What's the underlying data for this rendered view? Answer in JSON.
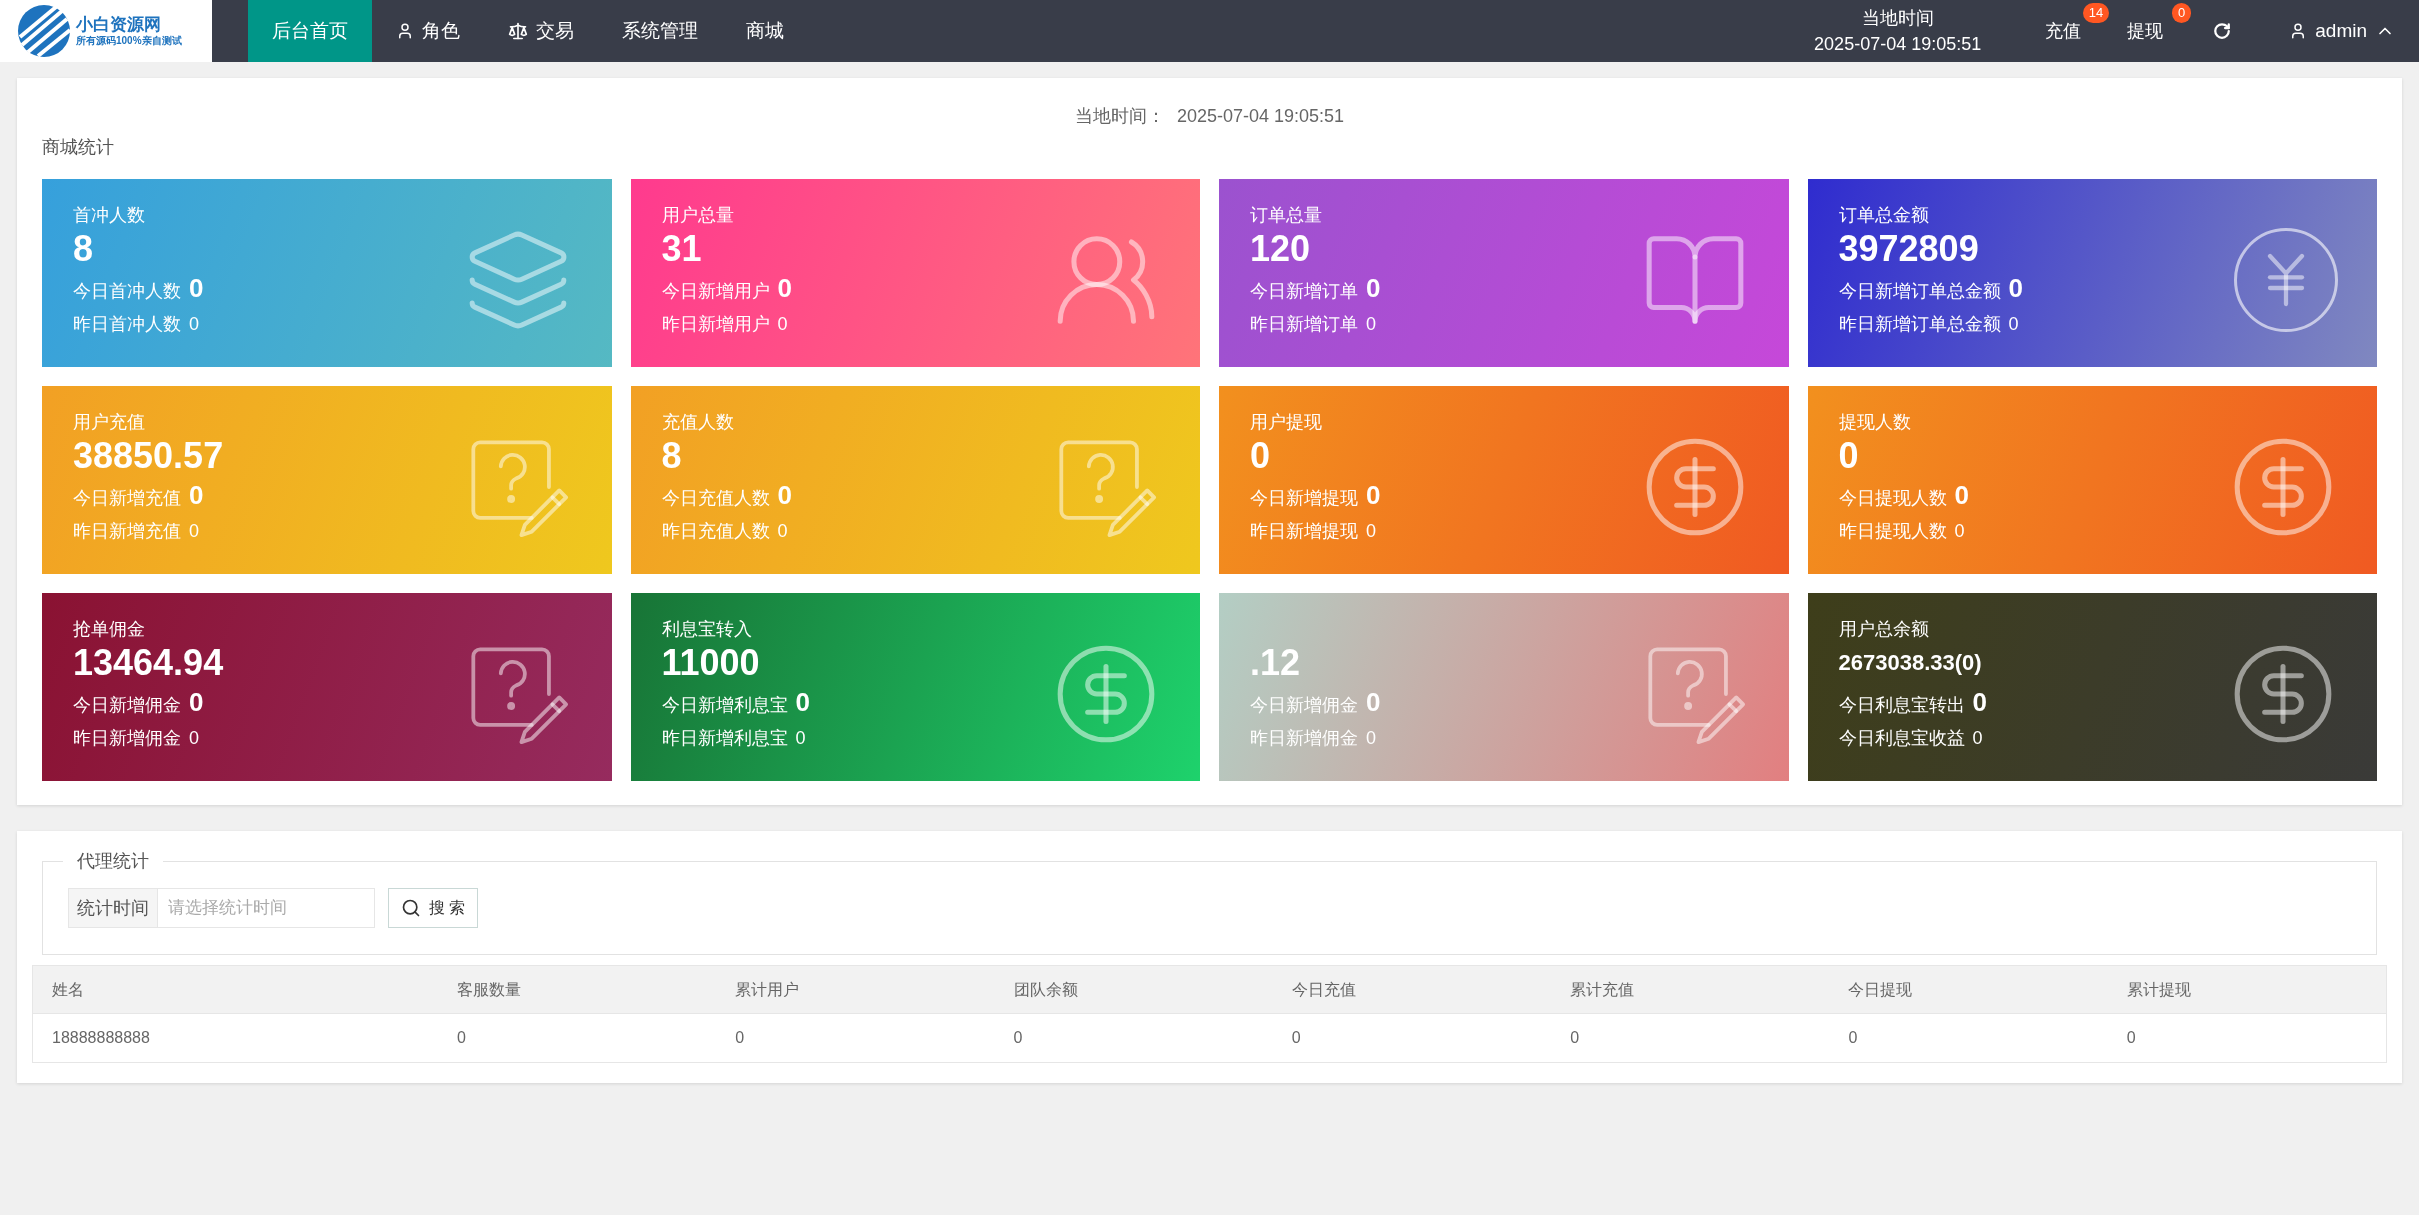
{
  "logo": {
    "title": "小白资源网",
    "subtitle": "所有源码100%亲自测试"
  },
  "nav": [
    {
      "label": "后台首页",
      "selected": true
    },
    {
      "label": "角色",
      "selected": false
    },
    {
      "label": "交易",
      "selected": false
    },
    {
      "label": "系统管理",
      "selected": false
    },
    {
      "label": "商城",
      "selected": false
    }
  ],
  "header_right": {
    "time_label": "当地时间",
    "time": "2025-07-04 19:05:51",
    "recharge": {
      "label": "充值",
      "badge": "14"
    },
    "withdraw": {
      "label": "提现",
      "badge": "0"
    },
    "user": "admin"
  },
  "mall_panel": {
    "time_label": "当地时间：",
    "time": "2025-07-04 19:05:51",
    "title": "商城统计",
    "cards": [
      {
        "title": "首冲人数",
        "value": "8",
        "today_label": "今日首冲人数",
        "today_value": "0",
        "yesterday_label": "昨日首冲人数",
        "yesterday_value": "0"
      },
      {
        "title": "用户总量",
        "value": "31",
        "today_label": "今日新增用户",
        "today_value": "0",
        "yesterday_label": "昨日新增用户",
        "yesterday_value": "0"
      },
      {
        "title": "订单总量",
        "value": "120",
        "today_label": "今日新增订单",
        "today_value": "0",
        "yesterday_label": "昨日新增订单",
        "yesterday_value": "0"
      },
      {
        "title": "订单总金额",
        "value": "3972809",
        "today_label": "今日新增订单总金额",
        "today_value": "0",
        "yesterday_label": "昨日新增订单总金额",
        "yesterday_value": "0"
      },
      {
        "title": "用户充值",
        "value": "38850.57",
        "today_label": "今日新增充值",
        "today_value": "0",
        "yesterday_label": "昨日新增充值",
        "yesterday_value": "0"
      },
      {
        "title": "充值人数",
        "value": "8",
        "today_label": "今日充值人数",
        "today_value": "0",
        "yesterday_label": "昨日充值人数",
        "yesterday_value": "0"
      },
      {
        "title": "用户提现",
        "value": "0",
        "today_label": "今日新增提现",
        "today_value": "0",
        "yesterday_label": "昨日新增提现",
        "yesterday_value": "0"
      },
      {
        "title": "提现人数",
        "value": "0",
        "today_label": "今日提现人数",
        "today_value": "0",
        "yesterday_label": "昨日提现人数",
        "yesterday_value": "0"
      },
      {
        "title": "抢单佣金",
        "value": "13464.94",
        "today_label": "今日新增佣金",
        "today_value": "0",
        "yesterday_label": "昨日新增佣金",
        "yesterday_value": "0"
      },
      {
        "title": "利息宝转入",
        "value": "11000",
        "today_label": "今日新增利息宝",
        "today_value": "0",
        "yesterday_label": "昨日新增利息宝",
        "yesterday_value": "0"
      },
      {
        "value": ".12",
        "today_label": "今日新增佣金",
        "today_value": "0",
        "yesterday_label": "昨日新增佣金",
        "yesterday_value": "0"
      },
      {
        "title": "用户总余额",
        "value": "2673038.33(0)",
        "today_label": "今日利息宝转出",
        "today_value": "0",
        "yesterday_label": "今日利息宝收益",
        "yesterday_value": "0"
      }
    ]
  },
  "agent_panel": {
    "legend": "代理统计",
    "filter_label": "统计时间",
    "filter_placeholder": "请选择统计时间",
    "search_button": "搜 索",
    "table": {
      "columns": [
        "姓名",
        "客服数量",
        "累计用户",
        "团队余额",
        "今日充值",
        "累计充值",
        "今日提现",
        "累计提现"
      ],
      "rows": [
        [
          "18888888888",
          "0",
          "0",
          "0",
          "0",
          "0",
          "0",
          "0"
        ]
      ]
    }
  }
}
